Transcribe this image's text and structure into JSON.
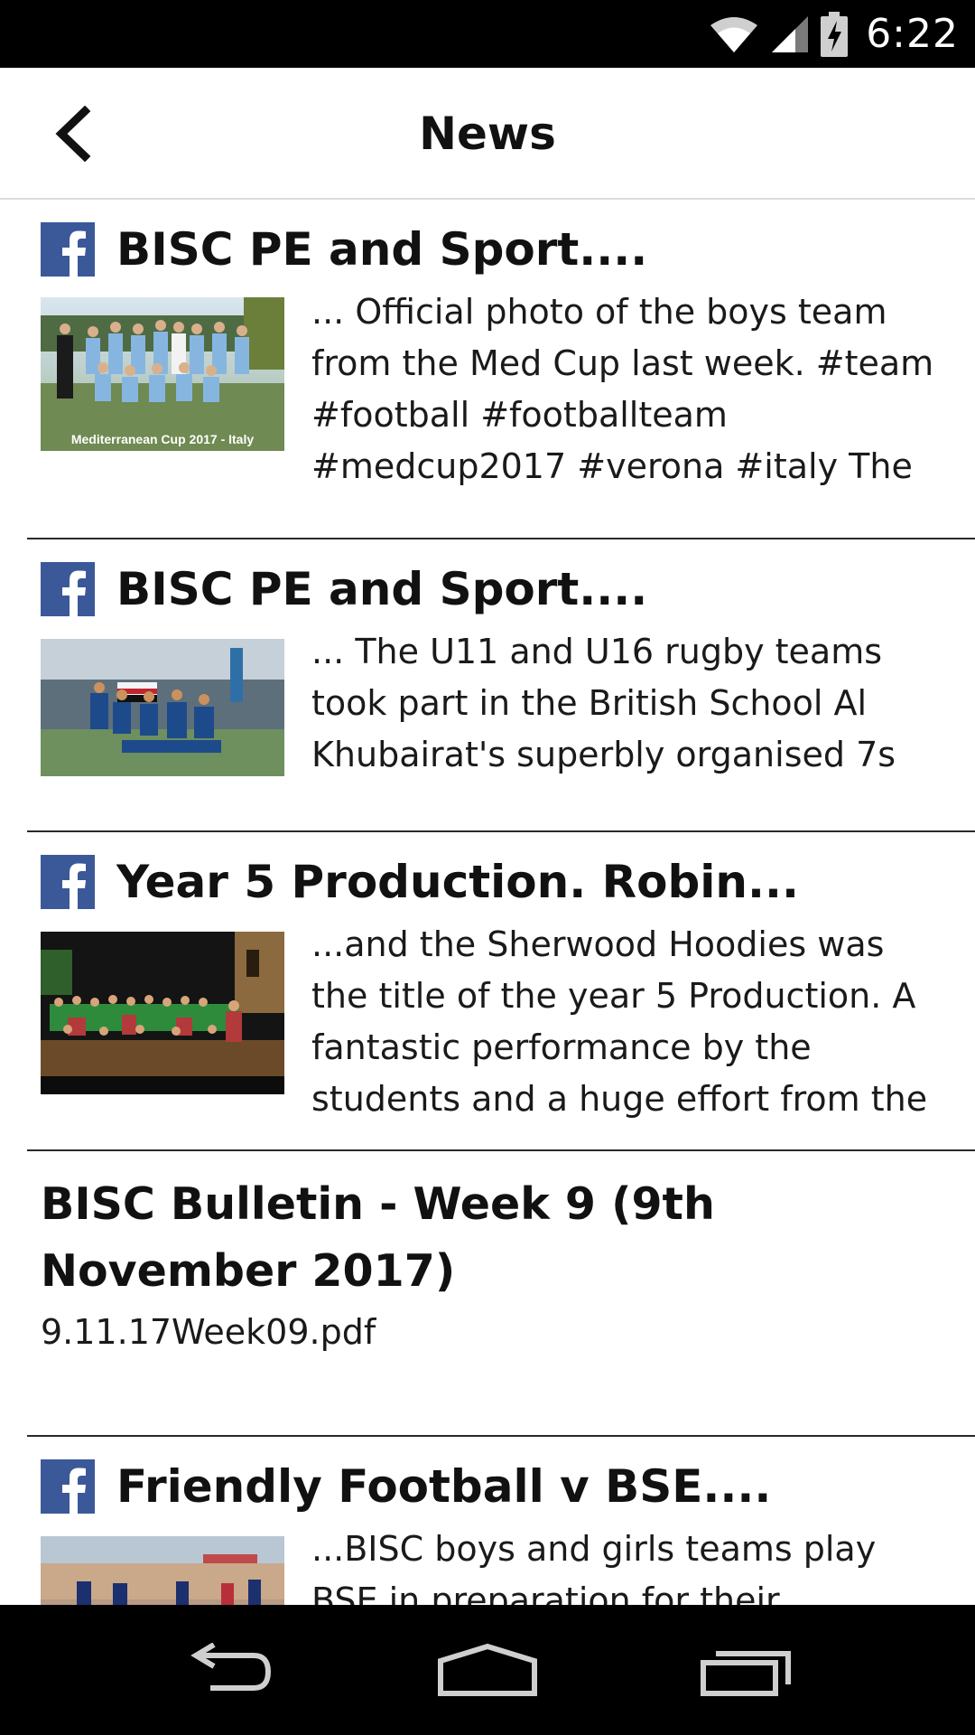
{
  "status_bar": {
    "time": "6:22",
    "icons": [
      "wifi-icon",
      "signal-icon",
      "battery-charging-icon"
    ]
  },
  "app_bar": {
    "title": "News",
    "back_icon": "chevron-left-icon"
  },
  "feed": {
    "items": [
      {
        "type": "facebook",
        "source_icon": "facebook-icon",
        "title": "BISC PE and Sport....",
        "thumbnail_caption": "Mediterranean Cup 2017 - Italy",
        "excerpt": "... Official photo of the boys team from the Med Cup last week. #team #football #footballteam #medcup2017 #verona #italy The"
      },
      {
        "type": "facebook",
        "source_icon": "facebook-icon",
        "title": "BISC PE and Sport....",
        "excerpt": "... The U11 and U16 rugby teams took part in the British School Al Khubairat's superbly organised 7s"
      },
      {
        "type": "facebook",
        "source_icon": "facebook-icon",
        "title": "Year 5 Production. Robin...",
        "excerpt": "...and the Sherwood Hoodies was the title of the year 5 Production. A fantastic performance by the students and a huge effort from the"
      },
      {
        "type": "document",
        "title": "BISC Bulletin - Week 9 (9th November 2017)",
        "file": "9.11.17Week09.pdf"
      },
      {
        "type": "facebook",
        "source_icon": "facebook-icon",
        "title": "Friendly Football v BSE....",
        "excerpt": "...BISC boys and girls teams play BSE in preparation for their"
      }
    ]
  },
  "nav_bar": {
    "icons": [
      "back-nav-icon",
      "home-nav-icon",
      "recents-nav-icon"
    ]
  },
  "colors": {
    "facebook_blue": "#3b5998",
    "status_bar_bg": "#000000",
    "nav_bar_bg": "#000000",
    "divider": "#2a2a2a"
  }
}
